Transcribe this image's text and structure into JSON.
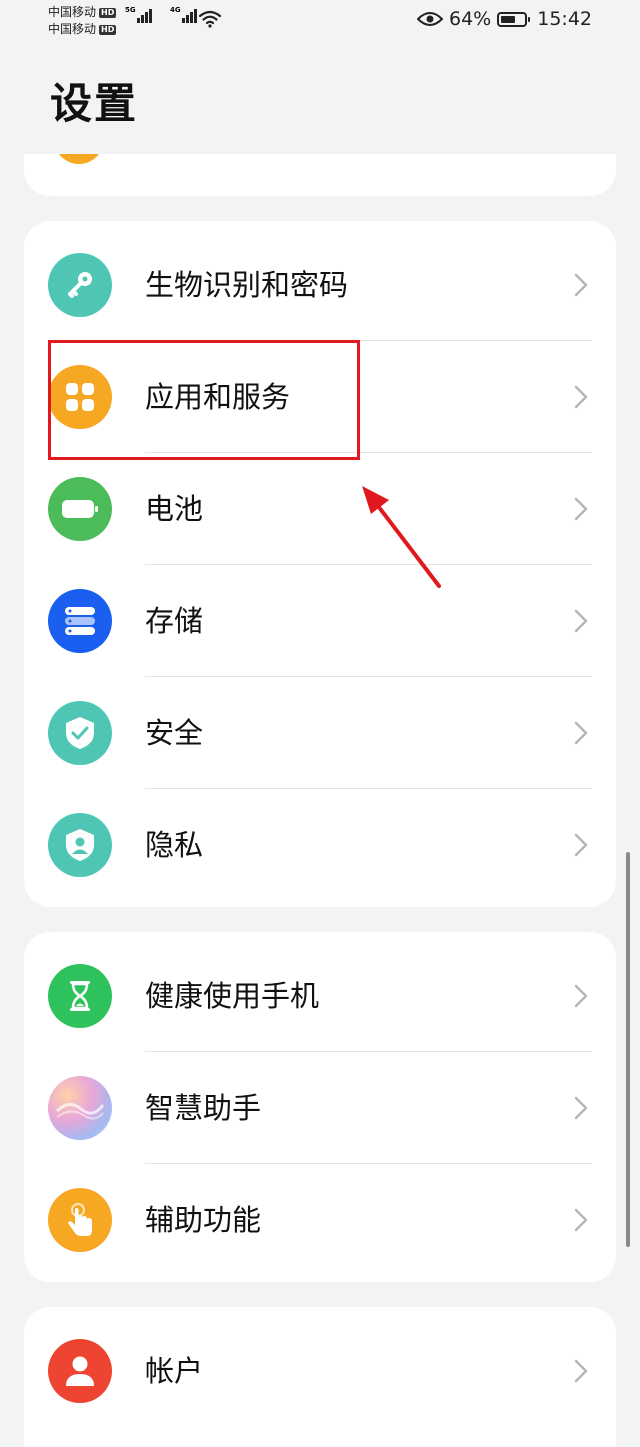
{
  "status_bar": {
    "carrier1": "中国移动",
    "carrier2": "中国移动",
    "hd_badge": "HD",
    "net1": "5G",
    "net2": "4G",
    "battery_percent": "64%",
    "battery_level": 0.64,
    "time": "15:42"
  },
  "page": {
    "title": "设置"
  },
  "groups": [
    {
      "items": [
        {
          "label": "生物识别和密码",
          "icon": "key-icon",
          "color": "#4fc6b4"
        },
        {
          "label": "应用和服务",
          "icon": "apps-grid-icon",
          "color": "#f7a823"
        },
        {
          "label": "电池",
          "icon": "battery-icon",
          "color": "#4cbc5a"
        },
        {
          "label": "存储",
          "icon": "storage-icon",
          "color": "#1a5ff0"
        },
        {
          "label": "安全",
          "icon": "shield-check-icon",
          "color": "#4fc6b4"
        },
        {
          "label": "隐私",
          "icon": "privacy-shield-icon",
          "color": "#4fc6b4"
        }
      ]
    },
    {
      "items": [
        {
          "label": "健康使用手机",
          "icon": "hourglass-icon",
          "color": "#2ec25c"
        },
        {
          "label": "智慧助手",
          "icon": "assistant-orb-icon",
          "color": "#c9a7e8"
        },
        {
          "label": "辅助功能",
          "icon": "hand-tap-icon",
          "color": "#f7a823"
        }
      ]
    },
    {
      "items": [
        {
          "label": "帐户",
          "icon": "user-icon",
          "color": "#ee4533"
        }
      ]
    }
  ],
  "annotation": {
    "box_color": "#e0191e",
    "arrow_color": "#e0191e"
  }
}
